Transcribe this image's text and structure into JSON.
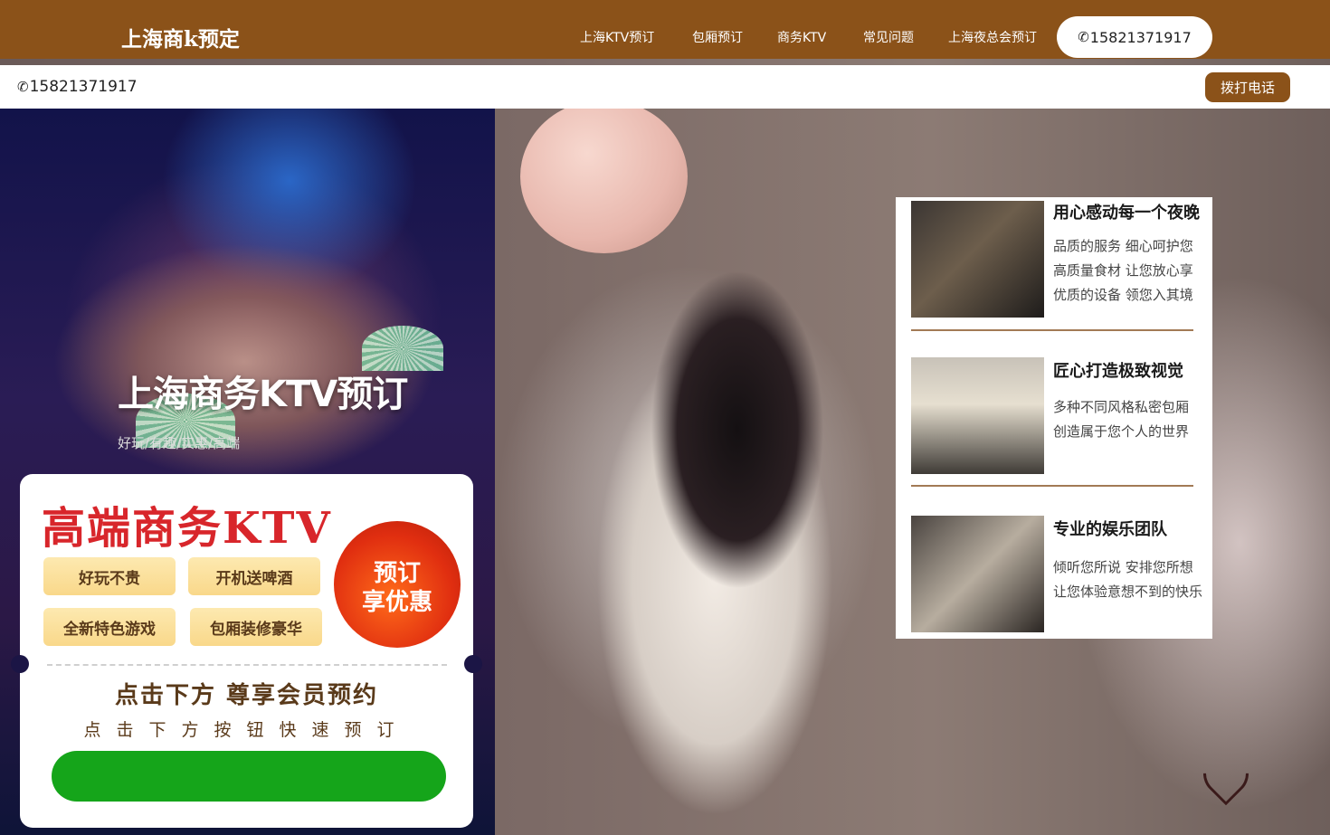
{
  "header": {
    "brand": "上海商k预定",
    "nav": [
      {
        "label": "上海KTV预订"
      },
      {
        "label": "包厢预订"
      },
      {
        "label": "商务KTV"
      },
      {
        "label": "常见问题"
      },
      {
        "label": "上海夜总会预订"
      }
    ],
    "phone_icon": "✆",
    "phone": "15821371917"
  },
  "callbar": {
    "phone_icon": "✆",
    "phone": "15821371917",
    "call_button": "拨打电话"
  },
  "hero": {
    "title": "上海商务KTV预订",
    "subtitle": "好玩/有趣/实惠/高端"
  },
  "promo": {
    "title": "高端商务KTV",
    "tags": [
      "好玩不贵",
      "开机送啤酒",
      "全新特色游戏",
      "包厢装修豪华"
    ],
    "badge_line1": "预订",
    "badge_line2": "享优惠",
    "cta": "点击下方 尊享会员预约",
    "hint": "点击下方按钮快速预订"
  },
  "features": [
    {
      "heading": "用心感动每一个夜晚",
      "lines": [
        "品质的服务 细心呵护您",
        "高质量食材 让您放心享",
        "优质的设备 领您入其境"
      ]
    },
    {
      "heading": "匠心打造极致视觉",
      "lines": [
        "多种不同风格私密包厢",
        "创造属于您个人的世界"
      ]
    },
    {
      "heading": "专业的娱乐团队",
      "lines": [
        "倾听您所说  安排您所想",
        "让您体验意想不到的快乐"
      ]
    }
  ],
  "colors": {
    "brand_brown": "#8b5219",
    "promo_red": "#d8262b",
    "cta_green": "#15a51a"
  }
}
